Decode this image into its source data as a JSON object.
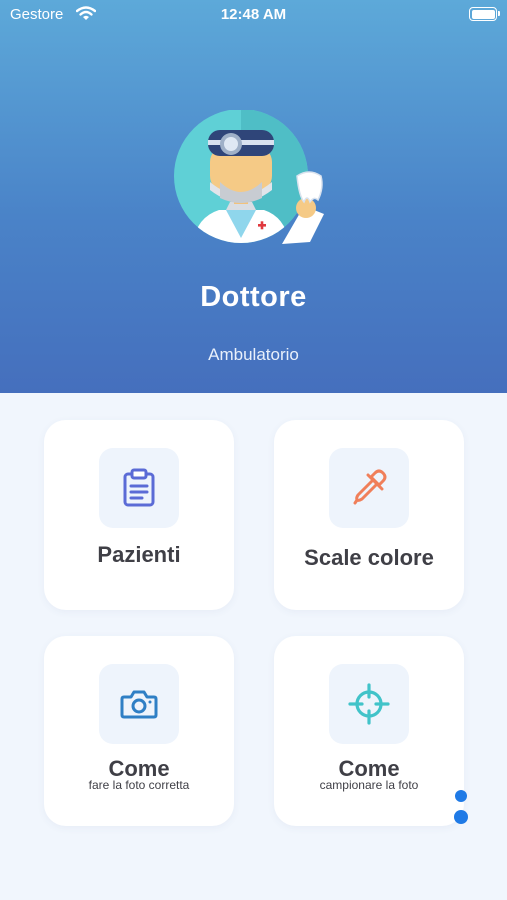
{
  "status_bar": {
    "carrier": "Gestore",
    "time": "12:48 AM"
  },
  "profile": {
    "name": "Dottore",
    "role": "Ambulatorio"
  },
  "cards": [
    {
      "title": "Pazienti",
      "icon": "clipboard-icon",
      "color": "#5b6bd6"
    },
    {
      "title": "Scale colore",
      "icon": "pipette-icon",
      "color": "#f07f5a"
    },
    {
      "title": "Come",
      "subtitle": "fare la foto corretta",
      "icon": "camera-icon",
      "color": "#2f7fc5"
    },
    {
      "title": "Come",
      "subtitle": "campionare la foto",
      "icon": "crosshair-icon",
      "color": "#41c3c9"
    }
  ],
  "colors": {
    "header_top": "#5da9d9",
    "header_bottom": "#456fbd",
    "background": "#f1f6fd",
    "loader": "#1f7ae6"
  }
}
